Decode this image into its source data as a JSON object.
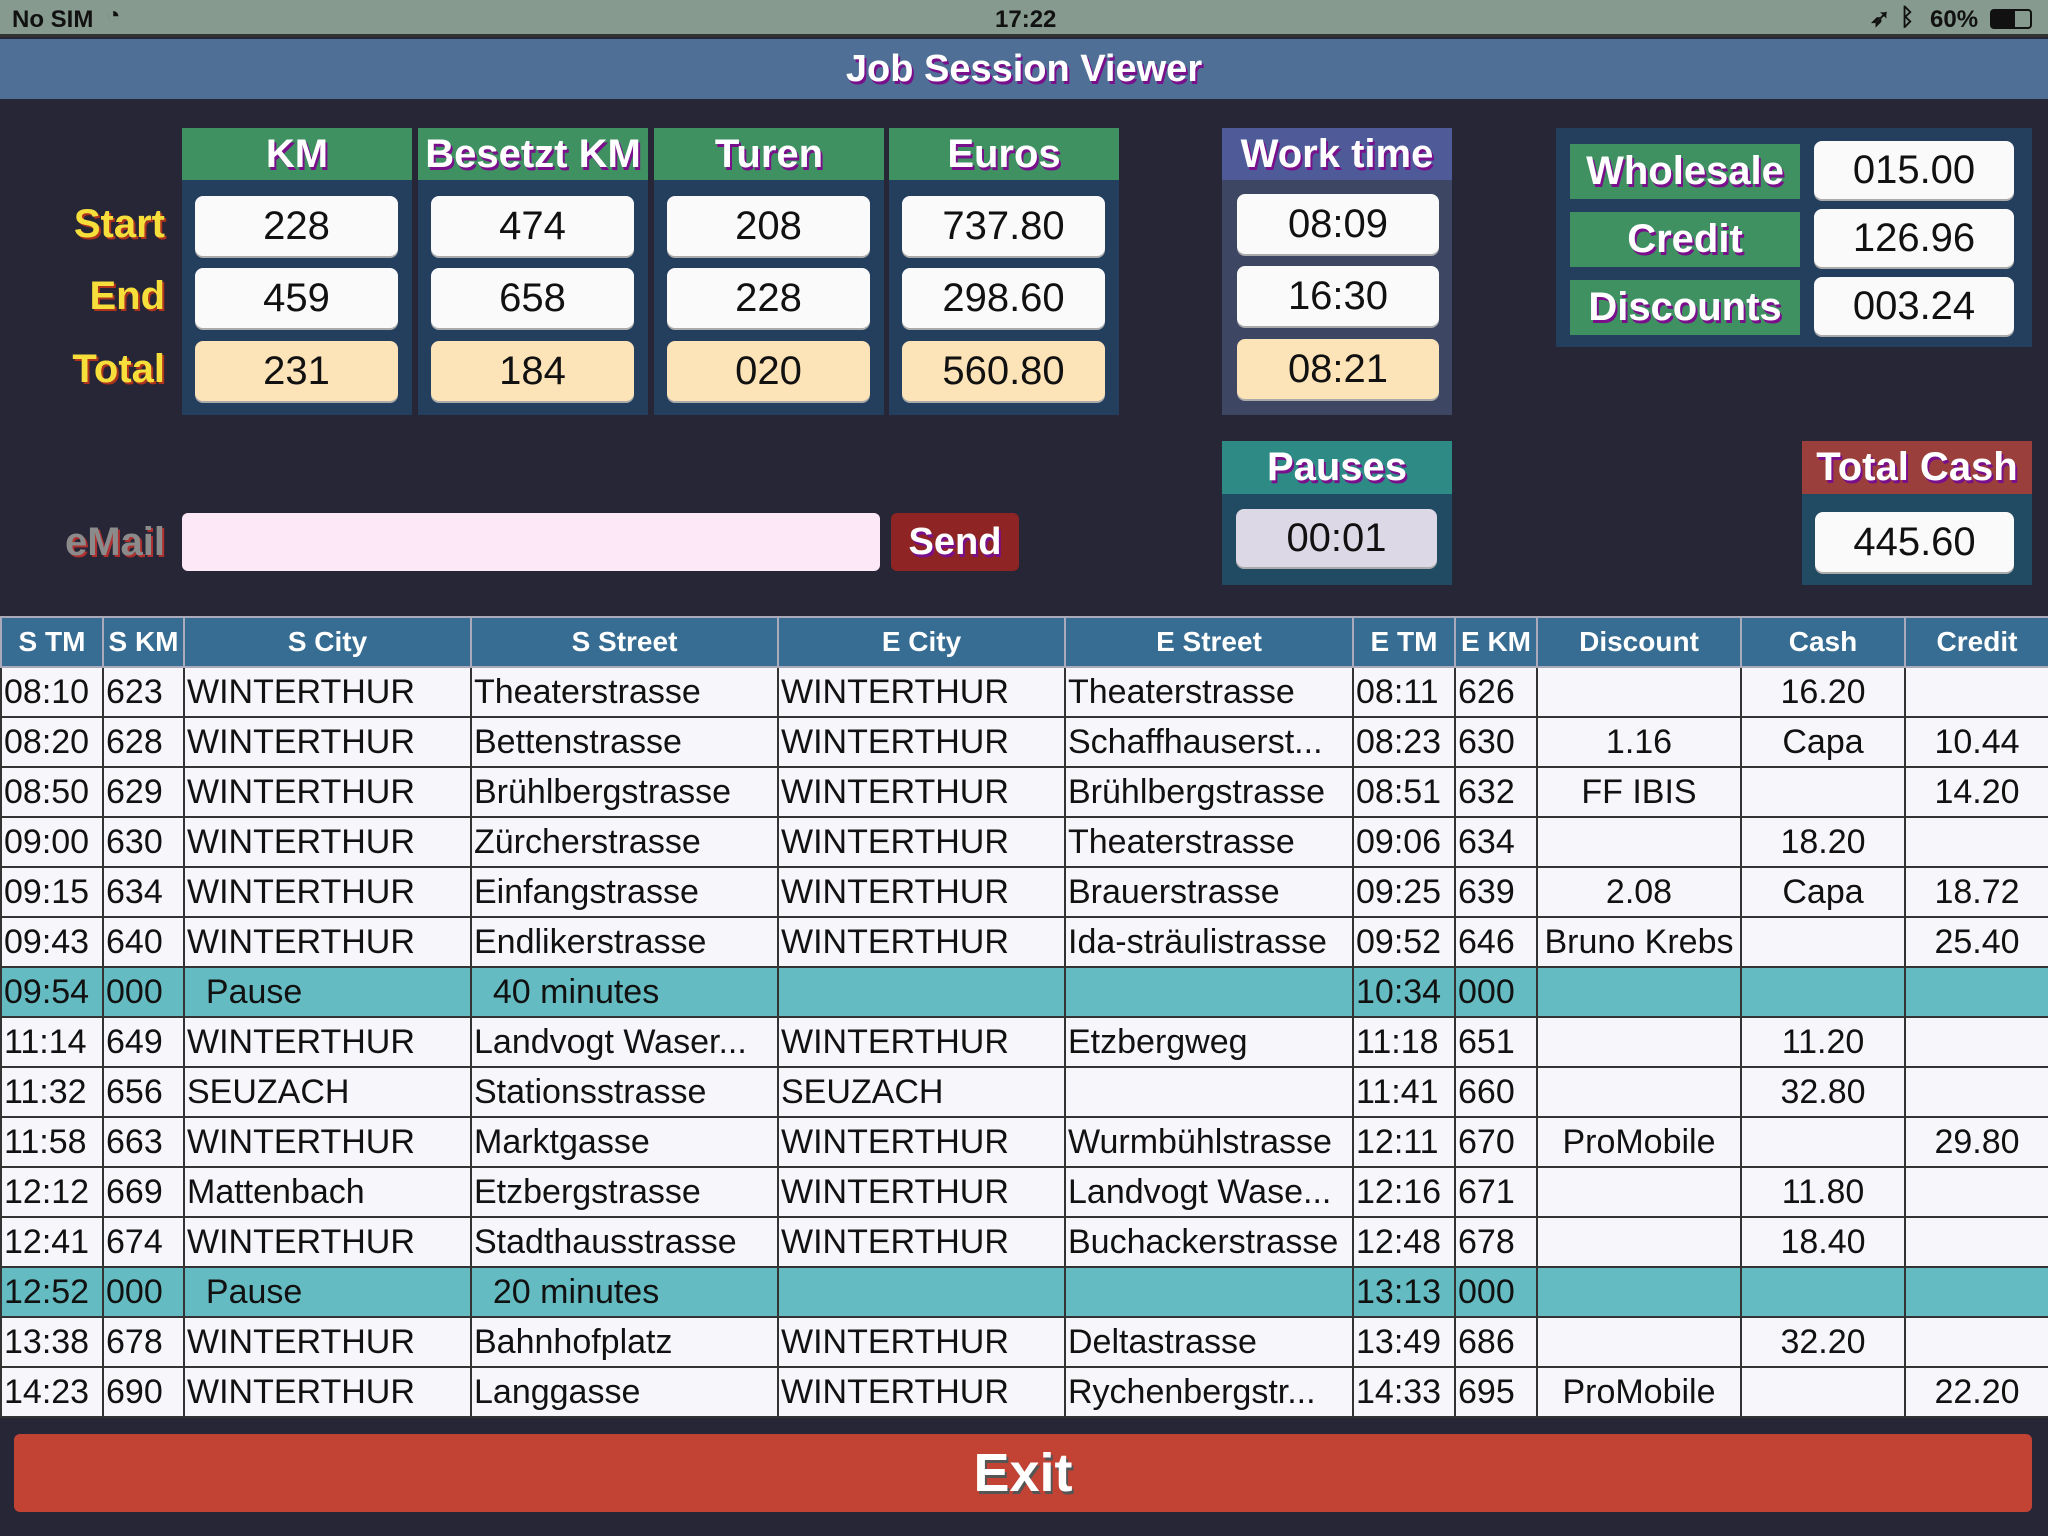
{
  "status": {
    "carrier": "No SIM",
    "time": "17:22",
    "battery": "60%"
  },
  "title": "Job Session Viewer",
  "summary": {
    "row_labels": [
      "Start",
      "End",
      "Total"
    ],
    "columns": [
      {
        "label": "KM",
        "values": [
          "228",
          "459",
          "231"
        ]
      },
      {
        "label": "Besetzt KM",
        "values": [
          "474",
          "658",
          "184"
        ]
      },
      {
        "label": "Turen",
        "values": [
          "208",
          "228",
          "020"
        ]
      },
      {
        "label": "Euros",
        "values": [
          "737.80",
          "298.60",
          "560.80"
        ]
      }
    ]
  },
  "work_time": {
    "label": "Work time",
    "values": [
      "08:09",
      "16:30",
      "08:21"
    ]
  },
  "right_panel": [
    {
      "label": "Wholesale",
      "value": "015.00"
    },
    {
      "label": "Credit",
      "value": "126.96"
    },
    {
      "label": "Discounts",
      "value": "003.24"
    }
  ],
  "pauses": {
    "label": "Pauses",
    "value": "00:01"
  },
  "total_cash": {
    "label": "Total Cash",
    "value": "445.60"
  },
  "email": {
    "label": "eMail",
    "value": "",
    "send": "Send"
  },
  "table": {
    "headers": [
      "S TM",
      "S KM",
      "S City",
      "S Street",
      "E City",
      "E Street",
      "E TM",
      "E KM",
      "Discount",
      "Cash",
      "Credit"
    ],
    "rows": [
      [
        "08:10",
        "623",
        "WINTERTHUR",
        "Theaterstrasse",
        "WINTERTHUR",
        "Theaterstrasse",
        "08:11",
        "626",
        "",
        "16.20",
        ""
      ],
      [
        "08:20",
        "628",
        "WINTERTHUR",
        "Bettenstrasse",
        "WINTERTHUR",
        "Schaffhauserst...",
        "08:23",
        "630",
        "1.16",
        "Capa",
        "10.44"
      ],
      [
        "08:50",
        "629",
        "WINTERTHUR",
        "Brühlbergstrasse",
        "WINTERTHUR",
        "Brühlbergstrasse",
        "08:51",
        "632",
        "FF IBIS",
        "",
        "14.20"
      ],
      [
        "09:00",
        "630",
        "WINTERTHUR",
        "Zürcherstrasse",
        "WINTERTHUR",
        "Theaterstrasse",
        "09:06",
        "634",
        "",
        "18.20",
        ""
      ],
      [
        "09:15",
        "634",
        "WINTERTHUR",
        "Einfangstrasse",
        "WINTERTHUR",
        "Brauerstrasse",
        "09:25",
        "639",
        "2.08",
        "Capa",
        "18.72"
      ],
      [
        "09:43",
        "640",
        "WINTERTHUR",
        "Endlikerstrasse",
        "WINTERTHUR",
        "Ida-sträulistrasse",
        "09:52",
        "646",
        "Bruno Krebs",
        "",
        "25.40"
      ],
      [
        "09:54",
        "000",
        "  Pause",
        "  40 minutes",
        "",
        "",
        "10:34",
        "000",
        "",
        "",
        ""
      ],
      [
        "11:14",
        "649",
        "WINTERTHUR",
        "Landvogt Waser...",
        "WINTERTHUR",
        "Etzbergweg",
        "11:18",
        "651",
        "",
        "11.20",
        ""
      ],
      [
        "11:32",
        "656",
        "SEUZACH",
        "Stationsstrasse",
        "SEUZACH",
        "",
        "11:41",
        "660",
        "",
        "32.80",
        ""
      ],
      [
        "11:58",
        "663",
        "WINTERTHUR",
        "Marktgasse",
        "WINTERTHUR",
        "Wurmbühlstrasse",
        "12:11",
        "670",
        "ProMobile",
        "",
        "29.80"
      ],
      [
        "12:12",
        "669",
        "Mattenbach",
        "Etzbergstrasse",
        "WINTERTHUR",
        "Landvogt Wase...",
        "12:16",
        "671",
        "",
        "11.80",
        ""
      ],
      [
        "12:41",
        "674",
        "WINTERTHUR",
        "Stadthausstrasse",
        "WINTERTHUR",
        "Buchackerstrasse",
        "12:48",
        "678",
        "",
        "18.40",
        ""
      ],
      [
        "12:52",
        "000",
        "  Pause",
        "  20 minutes",
        "",
        "",
        "13:13",
        "000",
        "",
        "",
        ""
      ],
      [
        "13:38",
        "678",
        "WINTERTHUR",
        "Bahnhofplatz",
        "WINTERTHUR",
        "Deltastrasse",
        "13:49",
        "686",
        "",
        "32.20",
        ""
      ],
      [
        "14:23",
        "690",
        "WINTERTHUR",
        "Langgasse",
        "WINTERTHUR",
        "Rychenbergstr...",
        "14:33",
        "695",
        "ProMobile",
        "",
        "22.20"
      ]
    ],
    "pause_rows": [
      6,
      12
    ]
  },
  "exit": "Exit",
  "colors": {
    "background": "#272636",
    "title_bar": "#4f6f96",
    "header_green": "#3f9162",
    "work_time": "#4f5b98",
    "pauses": "#2e8a85",
    "total_cash": "#9b3f3c",
    "send": "#8f2424",
    "exit": "#c24234",
    "pause_row": "#64bcc2",
    "table_header": "#376d93"
  }
}
